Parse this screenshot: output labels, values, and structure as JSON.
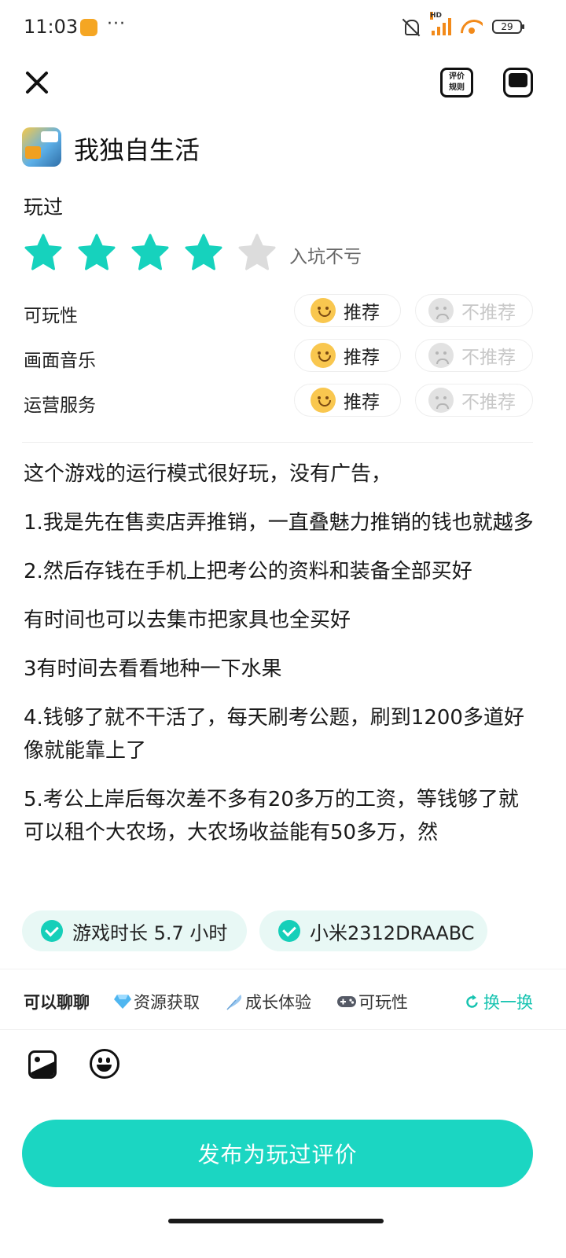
{
  "status_bar": {
    "time": "11:03",
    "more": "···",
    "network_label": "HD",
    "battery": "29"
  },
  "header": {
    "rules_line1": "评价",
    "rules_line2": "规则"
  },
  "game": {
    "title": "我独自生活"
  },
  "review": {
    "status_label": "玩过",
    "rating": 4,
    "rating_max": 5,
    "rating_text": "入坑不亏",
    "aspects": [
      {
        "label": "可玩性",
        "recommend": "推荐",
        "not_recommend": "不推荐",
        "selected": "recommend"
      },
      {
        "label": "画面音乐",
        "recommend": "推荐",
        "not_recommend": "不推荐",
        "selected": "recommend"
      },
      {
        "label": "运营服务",
        "recommend": "推荐",
        "not_recommend": "不推荐",
        "selected": "recommend"
      }
    ],
    "paragraphs": [
      "这个游戏的运行模式很好玩，没有广告，",
      "1.我是先在售卖店弄推销，一直叠魅力推销的钱也就越多",
      "2.然后存钱在手机上把考公的资料和装备全部买好",
      "有时间也可以去集市把家具也全买好",
      "3有时间去看看地种一下水果",
      "4.钱够了就不干活了，每天刷考公题，刷到1200多道好像就能靠上了",
      "5.考公上岸后每次差不多有20多万的工资，等钱够了就可以租个大农场，大农场收益能有50多万，然"
    ]
  },
  "tags": {
    "playtime": "游戏时长 5.7 小时",
    "device": "小米2312DRAABC"
  },
  "topics": {
    "items": [
      "可以聊聊",
      "资源获取",
      "成长体验",
      "可玩性"
    ],
    "refresh": "换一换"
  },
  "colors": {
    "accent": "#1bd6c2",
    "star_active": "#16d2bd",
    "star_inactive": "#dcdcdc"
  },
  "publish": {
    "label": "发布为玩过评价"
  }
}
